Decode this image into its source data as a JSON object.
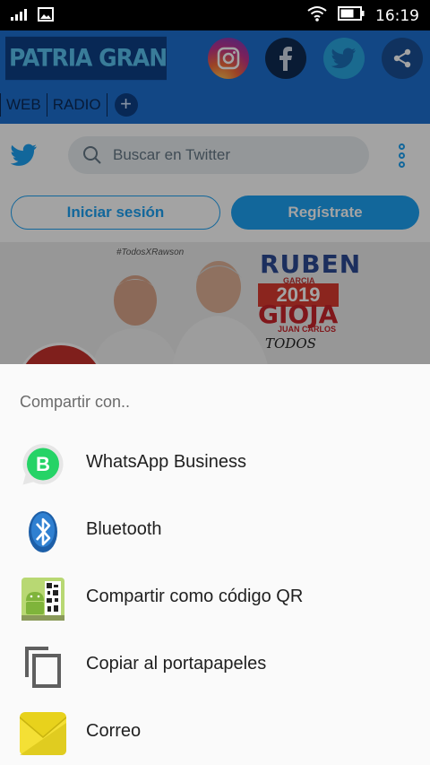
{
  "status_bar": {
    "time": "16:19",
    "icons": [
      "signal-icon",
      "image-notification-icon",
      "wifi-icon",
      "battery-icon"
    ]
  },
  "background_app": {
    "logo_text": "PATRIA GRANDE",
    "social_icons": [
      "instagram-icon",
      "facebook-icon",
      "twitter-icon",
      "share-icon"
    ],
    "tabs": [
      {
        "label": "WEB"
      },
      {
        "label": "RADIO"
      }
    ],
    "add_tab_symbol": "+",
    "twitter": {
      "search_placeholder": "Buscar en Twitter",
      "login_label": "Iniciar sesión",
      "register_label": "Regístrate"
    },
    "banner": {
      "hashtag": "#TodosXRawson",
      "name_top": "RUBEN",
      "name_sub": "GARCIA",
      "year": "2019",
      "surname": "GIOJA",
      "name_bottom": "JUAN CARLOS",
      "slogan": "TODOS"
    }
  },
  "share_sheet": {
    "title": "Compartir con..",
    "items": [
      {
        "label": "WhatsApp Business",
        "icon": "whatsapp-business-icon"
      },
      {
        "label": "Bluetooth",
        "icon": "bluetooth-icon"
      },
      {
        "label": "Compartir como código QR",
        "icon": "qr-code-icon"
      },
      {
        "label": "Copiar al portapapeles",
        "icon": "copy-icon"
      },
      {
        "label": "Correo",
        "icon": "mail-icon"
      }
    ]
  },
  "colors": {
    "header_blue": "#1d6fd0",
    "twitter_blue": "#1da1f2",
    "whatsapp_green": "#25d366",
    "sheet_background": "#fafafa"
  }
}
